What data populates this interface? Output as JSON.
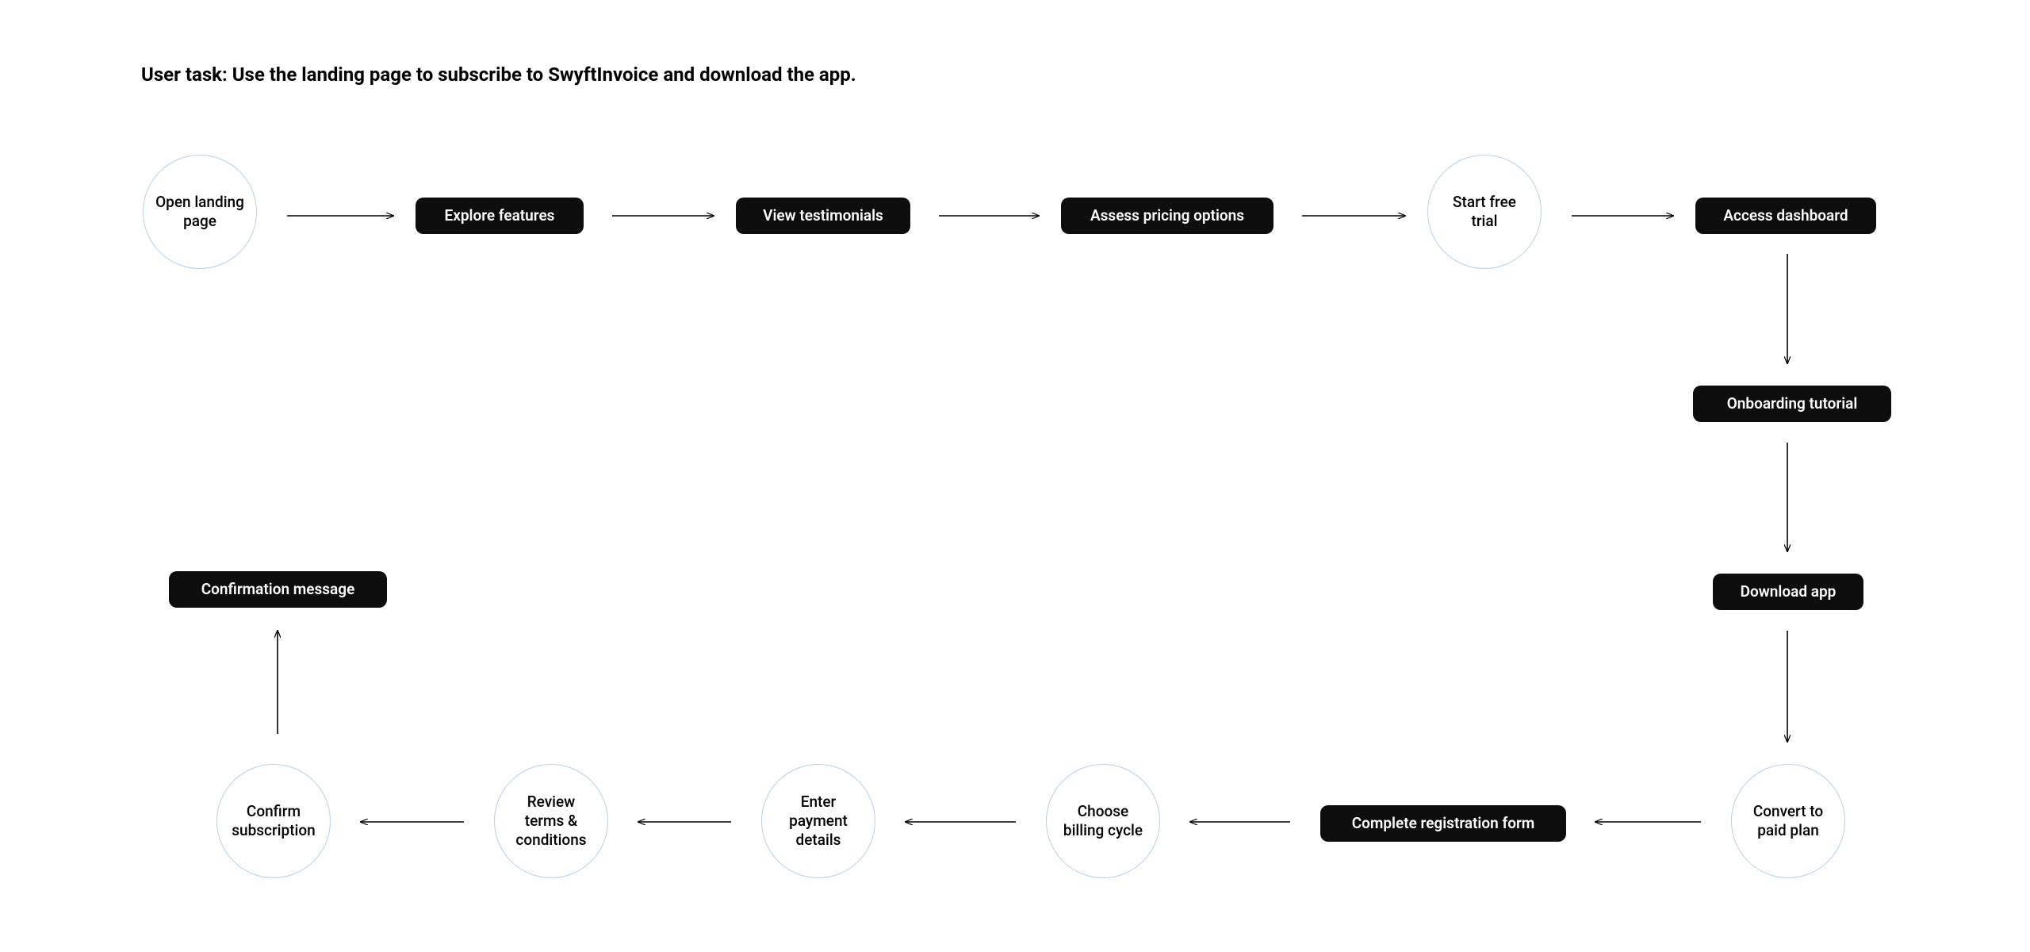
{
  "title": "User task: Use the landing page to subscribe to SwyftInvoice and download the app.",
  "nodes": {
    "open_landing": "Open landing page",
    "explore_features": "Explore features",
    "view_testimonials": "View testimonials",
    "assess_pricing": "Assess pricing options",
    "start_free_trial": "Start free trial",
    "access_dashboard": "Access dashboard",
    "onboarding": "Onboarding tutorial",
    "download_app": "Download app",
    "convert_paid": "Convert to paid plan",
    "complete_registration": "Complete registration form",
    "choose_billing": "Choose billing cycle",
    "enter_payment": "Enter payment details",
    "review_terms": "Review terms & conditions",
    "confirm_subscription": "Confirm subscription",
    "confirmation_message": "Confirmation message"
  }
}
